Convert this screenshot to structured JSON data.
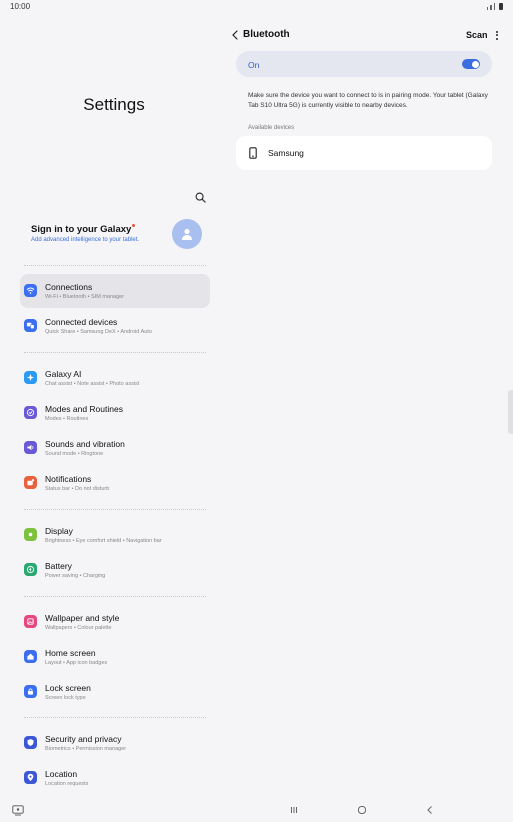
{
  "status": {
    "time": "10:00"
  },
  "left": {
    "title": "Settings",
    "account": {
      "title": "Sign in to your Galaxy",
      "subtitle": "Add advanced intelligence to your tablet."
    },
    "menu": [
      {
        "title": "Connections",
        "sub": "Wi-Fi  •  Bluetooth  •  SIM manager",
        "icon": "wifi-icon",
        "color": "#3c6ff0"
      },
      {
        "title": "Connected devices",
        "sub": "Quick Share  •  Samsung DeX  •  Android Auto",
        "icon": "connected-devices-icon",
        "color": "#3c6ff0"
      },
      {
        "title": "Galaxy AI",
        "sub": "Chat assist  •  Note assist  •  Photo assist",
        "icon": "galaxy-ai-icon",
        "color": "#2b9af3"
      },
      {
        "title": "Modes and Routines",
        "sub": "Modes  •  Routines",
        "icon": "modes-icon",
        "color": "#6a59d6"
      },
      {
        "title": "Sounds and vibration",
        "sub": "Sound mode  •  Ringtone",
        "icon": "sound-icon",
        "color": "#6a59d6"
      },
      {
        "title": "Notifications",
        "sub": "Status bar  •  Do not disturb",
        "icon": "notifications-icon",
        "color": "#e8613c"
      },
      {
        "title": "Display",
        "sub": "Brightness  •  Eye comfort shield  •  Navigation bar",
        "icon": "display-icon",
        "color": "#7cc23e"
      },
      {
        "title": "Battery",
        "sub": "Power saving  •  Charging",
        "icon": "battery-icon",
        "color": "#2ba872"
      },
      {
        "title": "Wallpaper and style",
        "sub": "Wallpapers  •  Colour palette",
        "icon": "wallpaper-icon",
        "color": "#e5487f"
      },
      {
        "title": "Home screen",
        "sub": "Layout  •  App icon badges",
        "icon": "home-icon",
        "color": "#3c6ff0"
      },
      {
        "title": "Lock screen",
        "sub": "Screen lock type",
        "icon": "lock-icon",
        "color": "#3c6ff0"
      },
      {
        "title": "Security and privacy",
        "sub": "Biometrics  •  Permission manager",
        "icon": "shield-icon",
        "color": "#3c57d6"
      },
      {
        "title": "Location",
        "sub": "Location requests",
        "icon": "location-icon",
        "color": "#3c57d6"
      }
    ]
  },
  "right": {
    "title": "Bluetooth",
    "scan_label": "Scan",
    "toggle_label": "On",
    "toggle_on": true,
    "description": "Make sure the device you want to connect to is in pairing mode. Your tablet (Galaxy Tab S10 Ultra 5G) is currently visible to nearby devices.",
    "section_label": "Available devices",
    "devices": [
      {
        "name": "Samsung"
      }
    ]
  },
  "colors": {
    "accent": "#3a6ee0",
    "background": "#f5f5f7",
    "card": "#ffffff"
  }
}
